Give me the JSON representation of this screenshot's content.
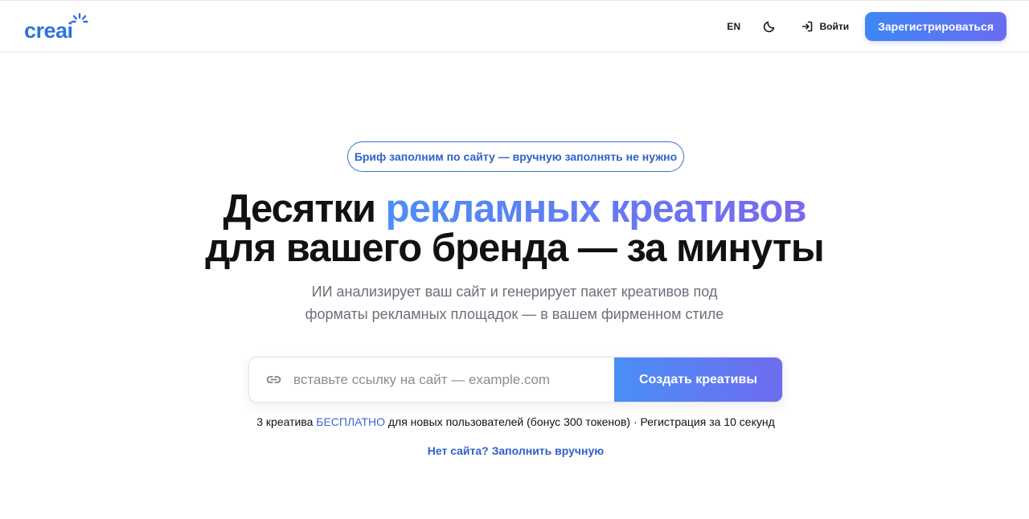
{
  "header": {
    "logo": {
      "text": "creai",
      "icon": "sparkle-rays-icon"
    },
    "lang_label": "EN",
    "theme_toggle_icon": "moon-icon",
    "login_icon": "sign-in-icon",
    "login_label": "Войти",
    "register_label": "Зарегистрироваться"
  },
  "hero": {
    "pill_text": "Бриф заполним по сайту — вручную заполнять не нужно",
    "headline": {
      "part1": "Десятки ",
      "accent": "рекламных креативов",
      "line2": "для вашего бренда — за минуты"
    },
    "subhead": {
      "line1": "ИИ анализирует ваш сайт и генерирует пакет креативов под",
      "line2": "форматы рекламных площадок — в вашем фирменном стиле"
    }
  },
  "url_form": {
    "link_icon": "link-icon",
    "placeholder": "вставьте ссылку на сайт — example.com",
    "value": "",
    "submit_label": "Создать креативы"
  },
  "promo": {
    "prefix": "3 креатива ",
    "free": "БЕСПЛАТНО",
    "suffix": " для новых пользователей (бонус 300 токенов) · Регистрация за 10 секунд"
  },
  "manual_link": "Нет сайта? Заполнить вручную",
  "colors": {
    "brand_blue": "#2e73e0",
    "accent_gradient_start": "#4a8ff6",
    "accent_gradient_end": "#6e6cf0",
    "link_blue": "#2f62c8"
  }
}
